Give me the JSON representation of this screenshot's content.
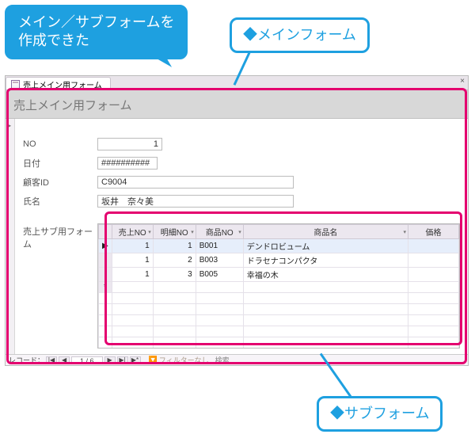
{
  "callouts": {
    "left": "メイン／サブフォームを\n作成できた",
    "right": "◆メインフォーム",
    "bottom": "◆サブフォーム"
  },
  "window": {
    "tab_label": "売上メイン用フォーム",
    "close_x": "×",
    "form_title": "売上メイン用フォーム"
  },
  "fields": {
    "no_label": "NO",
    "no_value": "1",
    "date_label": "日付",
    "date_value": "##########",
    "customer_label": "顧客ID",
    "customer_value": "C9004",
    "name_label": "氏名",
    "name_value": "坂井　奈々美"
  },
  "subform": {
    "label": "売上サブ用フォーム",
    "columns": {
      "sales_no": "売上NO",
      "detail_no": "明細NO",
      "product_no": "商品NO",
      "product_name": "商品名",
      "price": "価格"
    },
    "rows": [
      {
        "sales_no": "1",
        "detail_no": "1",
        "product_no": "B001",
        "product_name": "デンドロビューム",
        "price": ""
      },
      {
        "sales_no": "1",
        "detail_no": "2",
        "product_no": "B003",
        "product_name": "ドラセナコンパクタ",
        "price": ""
      },
      {
        "sales_no": "1",
        "detail_no": "3",
        "product_no": "B005",
        "product_name": "幸福の木",
        "price": ""
      }
    ]
  },
  "nav": {
    "label_record": "レコード：",
    "counter": "1 / 6",
    "first": "|◀",
    "prev": "◀",
    "next": "▶",
    "last": "▶|",
    "new": "▶*",
    "filter_label": "フィルターなし",
    "search_label": "検索"
  }
}
